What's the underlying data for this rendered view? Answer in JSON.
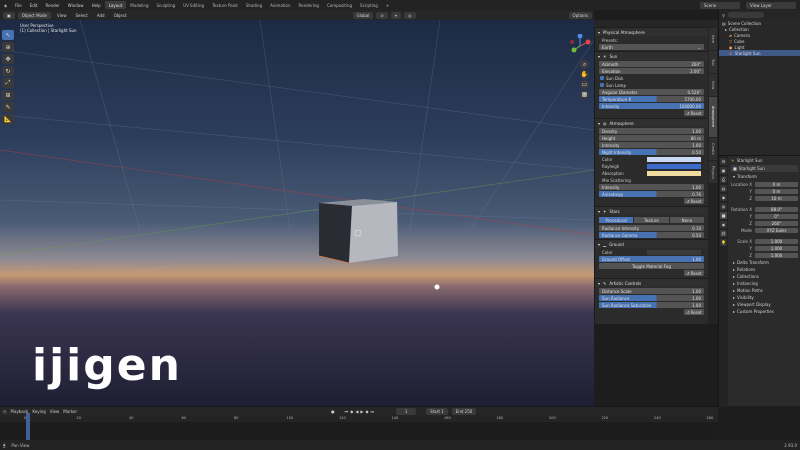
{
  "topbar": {
    "menus": [
      "File",
      "Edit",
      "Render",
      "Window",
      "Help"
    ],
    "workspaces": [
      "Layout",
      "Modeling",
      "Sculpting",
      "UV Editing",
      "Texture Paint",
      "Shading",
      "Animation",
      "Rendering",
      "Compositing",
      "Scripting"
    ],
    "active_workspace": "Layout",
    "scene": "Scene",
    "view_layer": "View Layer"
  },
  "viewport_header": {
    "mode": "Object Mode",
    "view": "View",
    "select": "Select",
    "add": "Add",
    "object": "Object",
    "orientation": "Global",
    "options": "Options"
  },
  "viewport": {
    "overlay_line1": "User Perspective",
    "overlay_line2": "(1) Collection | Starlight Sun",
    "logo": "ijigen"
  },
  "npanel": {
    "title": "Physical Atmosphere",
    "presets_label": "Presets:",
    "preset_value": "Earth",
    "sun": {
      "header": "Sun",
      "azimuth_label": "Azimuth",
      "azimuth_value": "260°",
      "elevation_label": "Elevation",
      "elevation_value": "2.00°",
      "sun_disk": "Sun Disk",
      "sun_lamp": "Sun Lamp",
      "angular_label": "Angular Diameter",
      "angular_value": "0.526°",
      "temp_label": "Temperature K",
      "temp_value": "5700.00",
      "intensity_label": "Intensity",
      "intensity_value": "100000.00",
      "reset": "Reset"
    },
    "atmosphere": {
      "header": "Atmosphere",
      "density_label": "Density",
      "density_value": "1.00",
      "height_label": "Height",
      "height_value": "80 m",
      "intensity_label": "Intensity",
      "intensity_value": "1.00",
      "night_label": "Night Intensity",
      "night_value": "0.50",
      "color_label": "Color",
      "absorption_label": "Absorption",
      "mie_label": "Mie Scattering",
      "mie_intensity_label": "Intensity",
      "mie_intensity_value": "1.00",
      "anisotropy_label": "Anisotropy",
      "anisotropy_value": "0.76",
      "reset": "Reset",
      "color_hex": "#c9d8f5",
      "scatter_hex": "#3b6ccb",
      "absorb_hex": "#f0dca0"
    },
    "stars": {
      "header": "Stars",
      "options": [
        "Procedural",
        "Texture",
        "None"
      ],
      "radiance_label": "Radiance Intensity",
      "radiance_value": "0.10",
      "gamma_label": "Radiance Gamma",
      "gamma_value": "0.50"
    },
    "ground": {
      "header": "Ground",
      "color_label": "Color",
      "offset_label": "Ground Offset",
      "offset_value": "1.00",
      "toggle_fog": "Toggle Material Fog",
      "reset": "Reset"
    },
    "artistic": {
      "header": "Artistic Controls",
      "distance_label": "Distance Scale",
      "distance_value": "1.00",
      "sun_radiance_label": "Sun Radiance",
      "sun_radiance_value": "1.00",
      "sun_radiance_sat_label": "Sun Radiance Saturation",
      "sun_radiance_sat_value": "1.00",
      "reset": "Reset"
    }
  },
  "npanel_tabs": [
    "Item",
    "Tool",
    "View",
    "Atmosphere",
    "Create",
    "Physics"
  ],
  "outliner": {
    "root": "Scene Collection",
    "items": [
      {
        "name": "Collection",
        "icon": "collection-icon"
      },
      {
        "name": "Camera",
        "icon": "camera-icon"
      },
      {
        "name": "Cube",
        "icon": "mesh-icon"
      },
      {
        "name": "Light",
        "icon": "light-icon"
      },
      {
        "name": "Starlight Sun",
        "icon": "sun-icon"
      }
    ]
  },
  "properties": {
    "object_name": "Starlight Sun",
    "data_name": "Starlight Sun",
    "transform_header": "Transform",
    "location": {
      "label": "Location X",
      "x": "0 m",
      "y": "0 m",
      "z": "10 m"
    },
    "rotation": {
      "label": "Rotation X",
      "x": "88.0°",
      "y": "0°",
      "z": "260°"
    },
    "mode_label": "Mode",
    "mode_value": "XYZ Euler",
    "scale": {
      "label": "Scale X",
      "x": "1.000",
      "y": "1.000",
      "z": "1.000"
    },
    "delta": "Delta Transform",
    "sections": [
      "Relations",
      "Collections",
      "Instancing",
      "Motion Paths",
      "Visibility",
      "Viewport Display",
      "Custom Properties"
    ]
  },
  "timeline": {
    "playback": "Playback",
    "keying": "Keying",
    "view": "View",
    "marker": "Marker",
    "current_frame": "1",
    "start_label": "Start",
    "start": "1",
    "end_label": "End",
    "end": "250",
    "ticks": [
      "0",
      "20",
      "40",
      "60",
      "80",
      "100",
      "120",
      "140",
      "160",
      "180",
      "200",
      "220",
      "240",
      "260"
    ]
  },
  "statusbar": {
    "left": "Pan View",
    "version": "2.93.0"
  }
}
